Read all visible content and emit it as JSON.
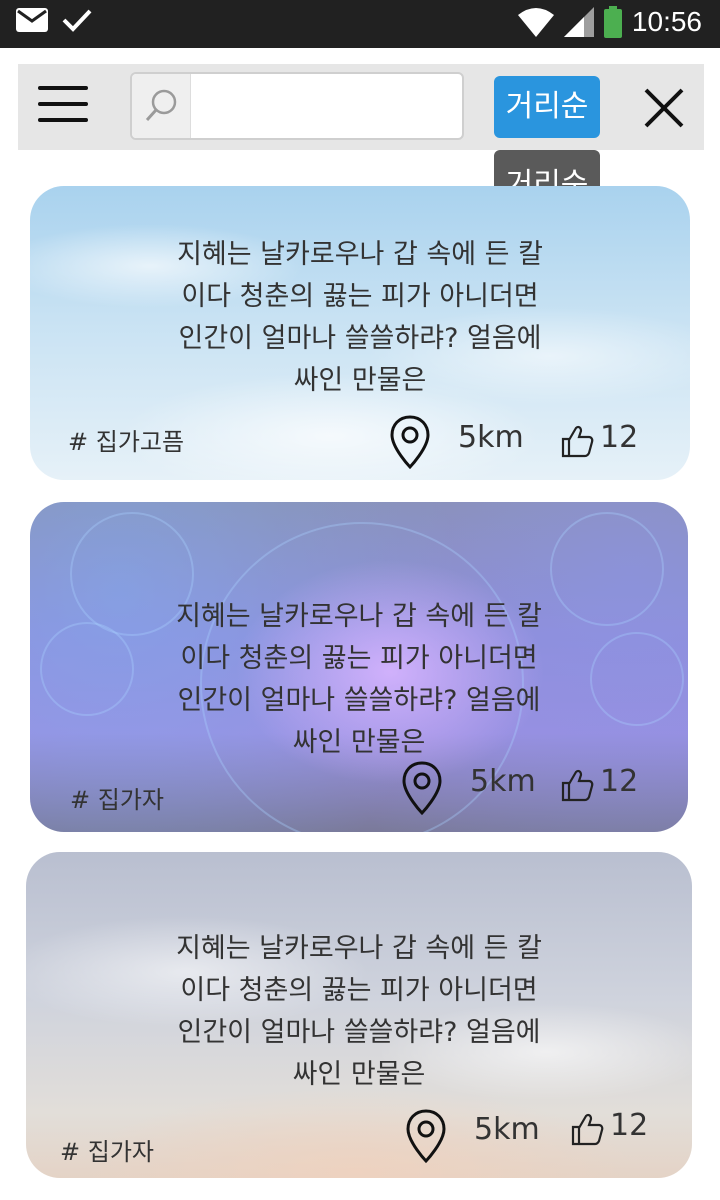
{
  "status_bar": {
    "time": "10:56",
    "icons": [
      "mail-icon",
      "check-icon",
      "wifi-icon",
      "signal-icon",
      "battery-icon"
    ],
    "battery_color": "#4caf50"
  },
  "topbar": {
    "search_placeholder": "",
    "search_value": "",
    "sort_label": "거리순",
    "sort_color": "#2a95de"
  },
  "tooltip": {
    "label": "거리순"
  },
  "cards": [
    {
      "lines": [
        "지혜는 날카로우나 갑 속에 든 칼",
        "이다 청춘의 끓는 피가 아니더면",
        "인간이 얼마나 쓸쓸하랴? 얼음에",
        "싸인 만물은"
      ],
      "tag": "# 집가고픔",
      "distance": "5km",
      "likes": "12",
      "background": "sky"
    },
    {
      "lines": [
        "지혜는 날카로우나 갑 속에 든 칼",
        "이다 청춘의 끓는 피가 아니더면",
        "인간이 얼마나 쓸쓸하랴? 얼음에",
        "싸인 만물은"
      ],
      "tag": "# 집가자",
      "distance": "5km",
      "likes": "12",
      "background": "zodiac-galaxy"
    },
    {
      "lines": [
        "지혜는 날카로우나 갑 속에 든 칼",
        "이다 청춘의 끓는 피가 아니더면",
        "인간이 얼마나 쓸쓸하랴? 얼음에",
        "싸인 만물은"
      ],
      "tag": "# 집가자",
      "distance": "5km",
      "likes": "12",
      "background": "cloudy-sky"
    }
  ]
}
